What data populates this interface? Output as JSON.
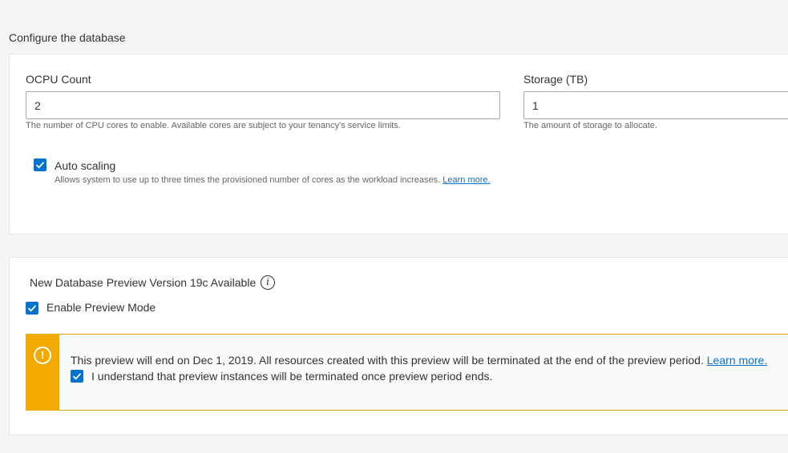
{
  "section": {
    "title": "Configure the database"
  },
  "ocpu": {
    "label": "OCPU Count",
    "value": "2",
    "help": "The number of CPU cores to enable. Available cores are subject to your tenancy's service limits."
  },
  "storage": {
    "label": "Storage (TB)",
    "value": "1",
    "help": "The amount of storage to allocate."
  },
  "autoscaling": {
    "label": "Auto scaling",
    "checked": true,
    "help": "Allows system to use up to three times the provisioned number of cores as the workload increases.",
    "link": "Learn more."
  },
  "preview": {
    "heading": "New Database Preview Version 19c Available",
    "info_icon": "i",
    "enable_label": "Enable Preview Mode",
    "enable_checked": true,
    "warning": {
      "icon": "!",
      "text": "This preview will end on Dec 1, 2019. All resources created with this preview will be terminated at the end of the preview period.",
      "link": "Learn more.",
      "ack_label": "I understand that preview instances will be terminated once preview period ends.",
      "ack_checked": true
    }
  },
  "colors": {
    "accent": "#0572ce",
    "warning": "#f2a900"
  }
}
